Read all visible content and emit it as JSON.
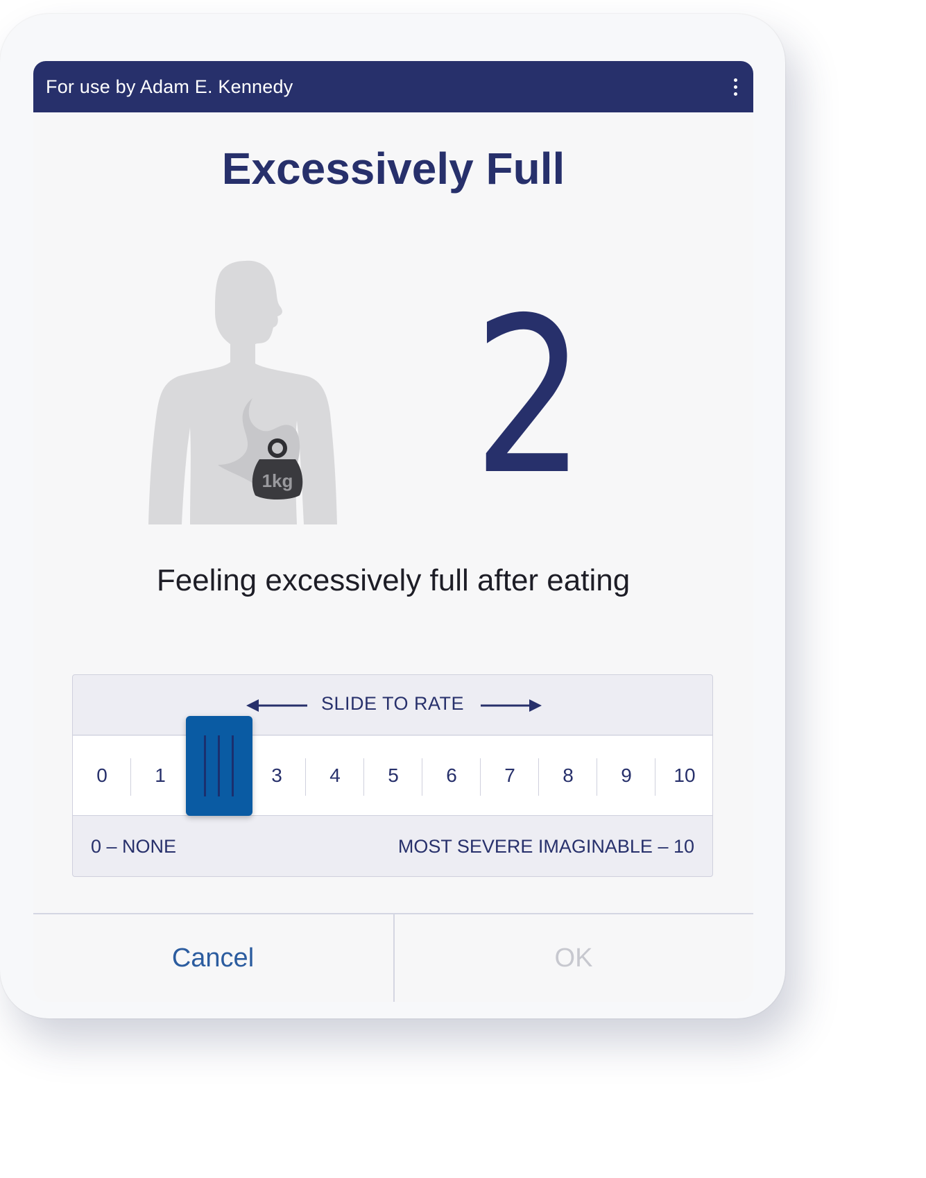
{
  "header": {
    "title": "For use by Adam E. Kennedy",
    "menu_icon": "more-vertical-icon"
  },
  "symptom": {
    "title": "Excessively Full",
    "description": "Feeling excessively full after eating",
    "illustration": "body-silhouette-with-stomach-weight",
    "weight_label": "1kg"
  },
  "rating": {
    "value": "2",
    "selected": 2,
    "min": 0,
    "max": 10
  },
  "slider": {
    "instruction": "SLIDE TO RATE",
    "scale": [
      "0",
      "1",
      "2",
      "3",
      "4",
      "5",
      "6",
      "7",
      "8",
      "9",
      "10"
    ],
    "min_label": "0 – NONE",
    "max_label": "MOST SEVERE IMAGINABLE – 10"
  },
  "actions": {
    "cancel_label": "Cancel",
    "ok_label": "OK"
  },
  "colors": {
    "primary_navy": "#27306b",
    "thumb_blue": "#0a5ba3",
    "cancel_blue": "#2b5c9f",
    "disabled_gray": "#c7c8cf"
  }
}
